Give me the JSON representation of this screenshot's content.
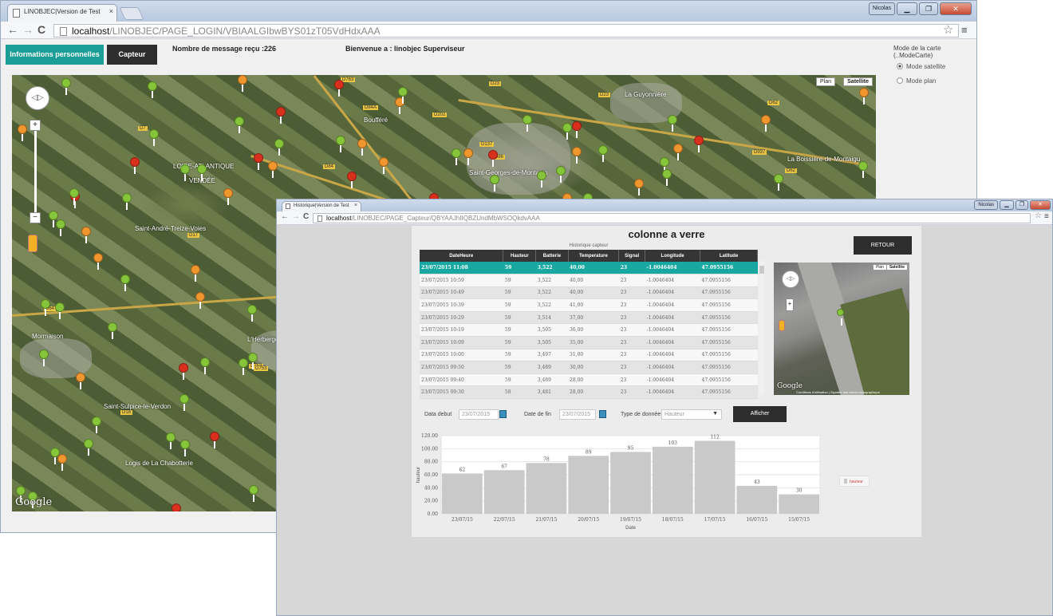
{
  "window1": {
    "tab_title": "LINOBJEC|Version de Test",
    "url_host": "localhost",
    "url_path": "/LINOBJEC/PAGE_LOGIN/VBIAALGIbwBYS01zT05VdHdxAAA",
    "user_label": "Nicolas",
    "nav": {
      "info_button": "Informations personnelles",
      "capteur_button": "Capteur"
    },
    "message_count": "Nombre de message reçu :226",
    "welcome": "Bienvenue a : linobjec Superviseur",
    "mode_title": "Mode de la carte (..ModeCarte)",
    "mode_satellite": "Mode satellite",
    "mode_plan": "Mode plan",
    "map": {
      "type_plan": "Plan",
      "type_satellite": "Satellite",
      "attribution": "Google",
      "places": [
        "La Guyonnière",
        "Boufféré",
        "Saint-Georges-de-Montaigu",
        "LOIRE-ATLANTIQUE",
        "VENDÉE",
        "Saint-André-Treize-Voies",
        "Mormaison",
        "L'Herbergement",
        "Saint-Sulpice-le-Verdon",
        "Logis de La Chabotterie",
        "La Boissière-de-Montaigu"
      ],
      "roads": [
        "D763",
        "D23",
        "D84A",
        "D202",
        "D753",
        "D137",
        "D86",
        "D84",
        "D62",
        "D7",
        "D64",
        "D17",
        "D18",
        "D753",
        "D23",
        "D62",
        "D937"
      ]
    }
  },
  "window2": {
    "tab_title": "Historique|Version de Test",
    "url_host": "localhost",
    "url_path": "/LINOBJEC/PAGE_Capteur/QBYAAJhIIQBZUndMbWSOQkdvAAA",
    "user_label": "Nicolas",
    "page_title": "colonne a verre",
    "retour": "RETOUR",
    "table_caption": "Historique capteur",
    "columns": [
      "DateHeure",
      "Hauteur",
      "Batterie",
      "Temperature",
      "Signal",
      "Longitude",
      "Latitude"
    ],
    "rows": [
      [
        "23/07/2015 11:08",
        "59",
        "3,522",
        "40,00",
        "23",
        "-1.0046404",
        "47.0955156"
      ],
      [
        "23/07/2015 10:59",
        "59",
        "3,522",
        "40,00",
        "23",
        "-1.0046404",
        "47.0955156"
      ],
      [
        "23/07/2015 10:49",
        "59",
        "3,522",
        "40,00",
        "23",
        "-1.0046404",
        "47.0955156"
      ],
      [
        "23/07/2015 10:39",
        "59",
        "3,522",
        "41,00",
        "23",
        "-1.0046404",
        "47.0955156"
      ],
      [
        "23/07/2015 10:29",
        "59",
        "3,514",
        "37,00",
        "23",
        "-1.0046404",
        "47.0955156"
      ],
      [
        "23/07/2015 10:19",
        "59",
        "3,505",
        "36,00",
        "23",
        "-1.0046404",
        "47.0955156"
      ],
      [
        "23/07/2015 10:09",
        "59",
        "3,505",
        "35,00",
        "23",
        "-1.0046404",
        "47.0955156"
      ],
      [
        "23/07/2015 10:00",
        "59",
        "3,497",
        "31,00",
        "23",
        "-1.0046404",
        "47.0955156"
      ],
      [
        "23/07/2015 09:50",
        "59",
        "3,489",
        "30,00",
        "23",
        "-1.0046404",
        "47.0955156"
      ],
      [
        "23/07/2015 09:40",
        "59",
        "3,489",
        "28,00",
        "23",
        "-1.0046404",
        "47.0955156"
      ],
      [
        "23/07/2015 09:30",
        "58",
        "3,481",
        "28,00",
        "23",
        "-1.0046404",
        "47.0955156"
      ]
    ],
    "map": {
      "type_plan": "Plan",
      "type_satellite": "Satellite",
      "attribution": "Google",
      "footer": "Conditions d'utilisation | Signaler une erreur cartographique"
    },
    "filters": {
      "date_debut_label": "Data debut",
      "date_debut": "23/07/2015",
      "date_fin_label": "Date de fin",
      "date_fin": "23/07/2015",
      "type_label": "Type de donnée",
      "type_value": "Hauteur",
      "afficher": "Afficher"
    }
  },
  "chart_data": {
    "type": "bar",
    "categories": [
      "23/07/15",
      "22/07/15",
      "21/07/15",
      "20/07/15",
      "19/07/15",
      "18/07/15",
      "17/07/15",
      "16/07/15",
      "15/07/15"
    ],
    "values": [
      62,
      67,
      78,
      89,
      95,
      103,
      112,
      43,
      30
    ],
    "xlabel": "Date",
    "ylabel": "hauteur",
    "ylim": [
      0,
      120
    ],
    "yticks": [
      "0.00",
      "20.00",
      "40.00",
      "60.00",
      "80.00",
      "100.00",
      "120.00"
    ],
    "legend": "hauteur",
    "bar_color": "#c9c9c9",
    "grid": true
  },
  "colors": {
    "accent": "#1a9d96",
    "dark_button": "#2d2d2d",
    "selected_row": "#18a8a1"
  }
}
